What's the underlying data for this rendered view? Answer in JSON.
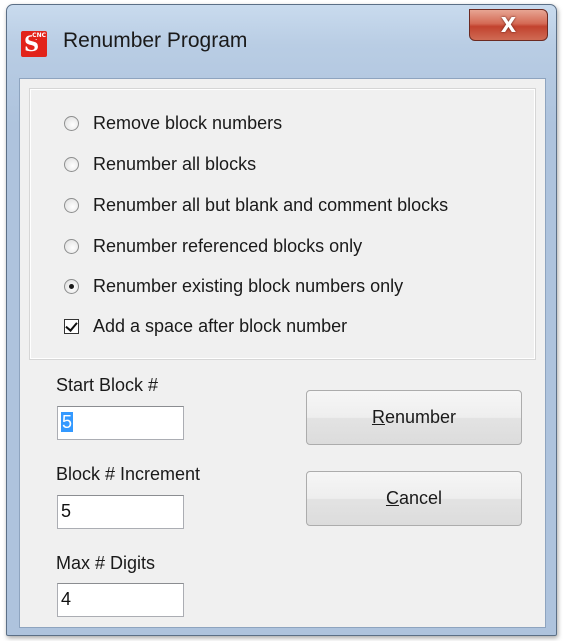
{
  "window": {
    "title": "Renumber Program",
    "app_icon_letter": "S",
    "app_icon_badge": "CNC",
    "close_glyph": "X"
  },
  "options": [
    {
      "label": "Remove block numbers",
      "type": "radio",
      "checked": false
    },
    {
      "label": "Renumber all blocks",
      "type": "radio",
      "checked": false
    },
    {
      "label": "Renumber all but blank and comment blocks",
      "type": "radio",
      "checked": false
    },
    {
      "label": "Renumber referenced blocks only",
      "type": "radio",
      "checked": false
    },
    {
      "label": "Renumber existing block numbers only",
      "type": "radio",
      "checked": true
    },
    {
      "label": "Add a space after block number",
      "type": "checkbox",
      "checked": true
    }
  ],
  "fields": {
    "start_block": {
      "label": "Start Block #",
      "value": "5",
      "selected": true
    },
    "increment": {
      "label": "Block # Increment",
      "value": "5"
    },
    "max_digits": {
      "label": "Max # Digits",
      "value": "4"
    }
  },
  "buttons": {
    "renumber": {
      "mnemonic": "R",
      "rest": "enumber"
    },
    "cancel": {
      "mnemonic": "C",
      "rest": "ancel"
    }
  },
  "colors": {
    "selection": "#3399ff",
    "close_button": "#c7432f",
    "dialog_face": "#f0f0f0"
  }
}
